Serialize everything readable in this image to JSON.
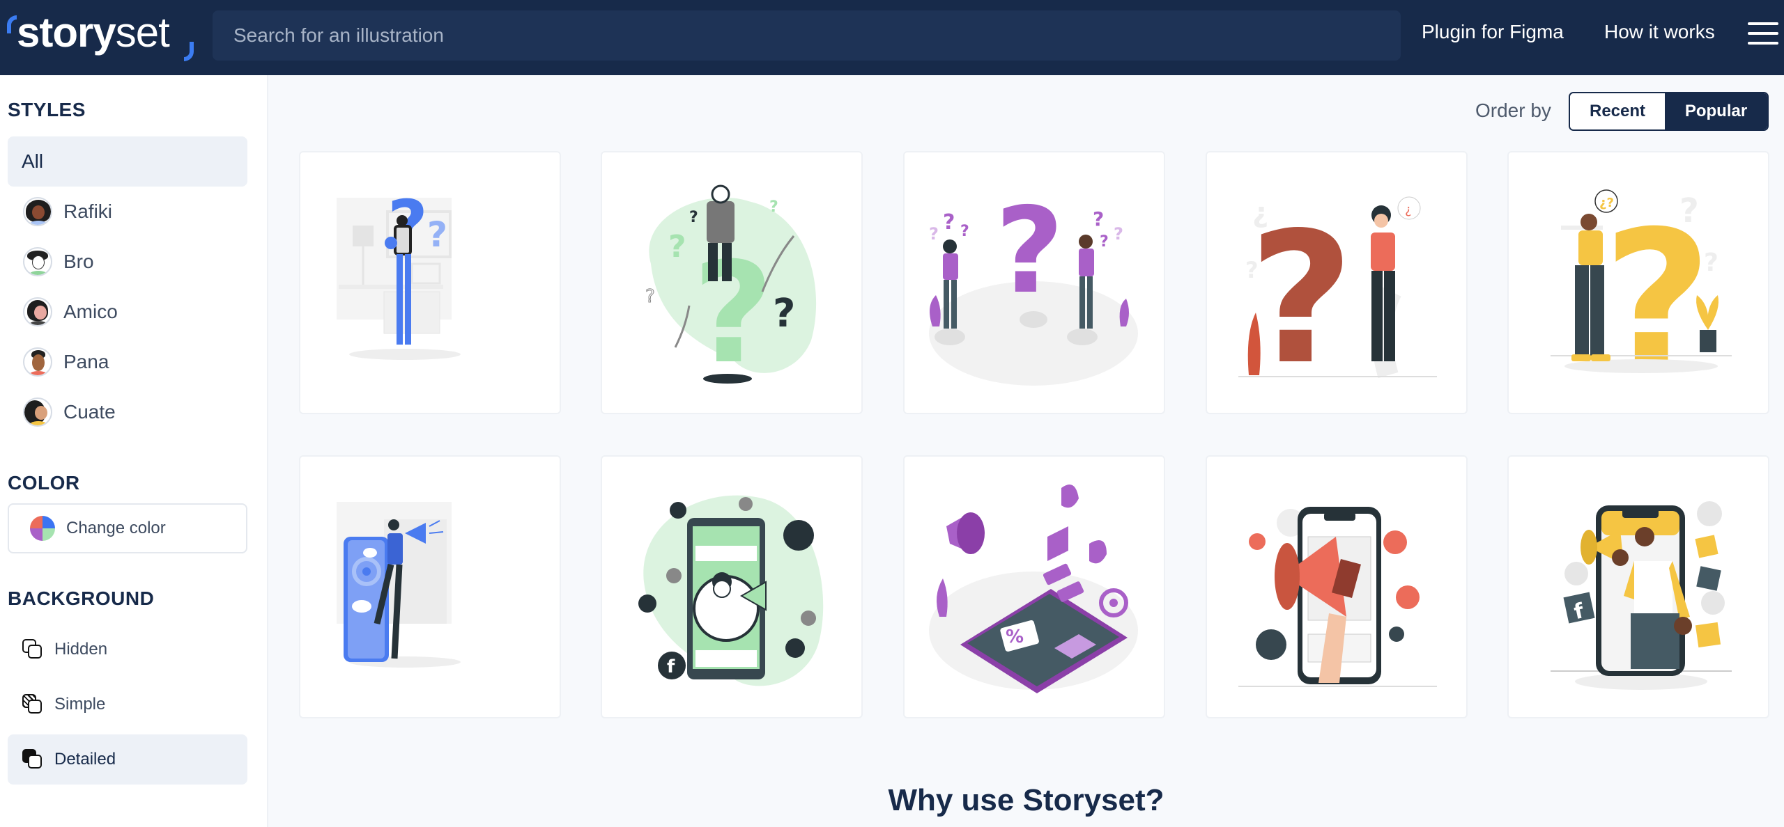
{
  "header": {
    "logo_bold": "story",
    "logo_light": "set",
    "search_placeholder": "Search for an illustration",
    "search_value": "",
    "nav": [
      {
        "label": "Plugin for Figma"
      },
      {
        "label": "How it works"
      }
    ],
    "menu_icon": "hamburger-menu-icon"
  },
  "sidebar": {
    "styles_title": "STYLES",
    "styles": [
      {
        "label": "All",
        "active": true
      },
      {
        "label": "Rafiki",
        "avatar": "rafiki-avatar"
      },
      {
        "label": "Bro",
        "avatar": "bro-avatar"
      },
      {
        "label": "Amico",
        "avatar": "amico-avatar"
      },
      {
        "label": "Pana",
        "avatar": "pana-avatar"
      },
      {
        "label": "Cuate",
        "avatar": "cuate-avatar"
      }
    ],
    "color_title": "COLOR",
    "change_color_label": "Change color",
    "color_wheel_colors": [
      "#ec6c5a",
      "#3b74f2",
      "#a960c8",
      "#a6e3b0"
    ],
    "background_title": "BACKGROUND",
    "backgrounds": [
      {
        "label": "Hidden",
        "icon": "background-hidden-icon"
      },
      {
        "label": "Simple",
        "icon": "background-simple-icon"
      },
      {
        "label": "Detailed",
        "icon": "background-detailed-icon",
        "active": true
      }
    ]
  },
  "main": {
    "order_by_label": "Order by",
    "order_options": [
      {
        "label": "Recent",
        "selected": false
      },
      {
        "label": "Popular",
        "selected": true
      }
    ],
    "illustrations": [
      {
        "subject": "man with question mark in room",
        "accent": "#4a7bf0"
      },
      {
        "subject": "man sitting on question mark with plants",
        "accent": "#a6e3b0"
      },
      {
        "subject": "two people confused with 3D question mark",
        "accent": "#a960c8"
      },
      {
        "subject": "woman leaning on big question mark",
        "accent": "#c9553f"
      },
      {
        "subject": "man thinking beside yellow question mark",
        "accent": "#f5c543"
      },
      {
        "subject": "man with megaphone and phone",
        "accent": "#4a7bf0"
      },
      {
        "subject": "man with megaphone in phone with social icons",
        "accent": "#a6e3b0"
      },
      {
        "subject": "isometric phone marketing with megaphone",
        "accent": "#a960c8"
      },
      {
        "subject": "hand holding megaphone from phone",
        "accent": "#ec6c5a"
      },
      {
        "subject": "man with megaphone in phone and social icons",
        "accent": "#f5c543"
      }
    ],
    "why_title": "Why use Storyset?"
  }
}
